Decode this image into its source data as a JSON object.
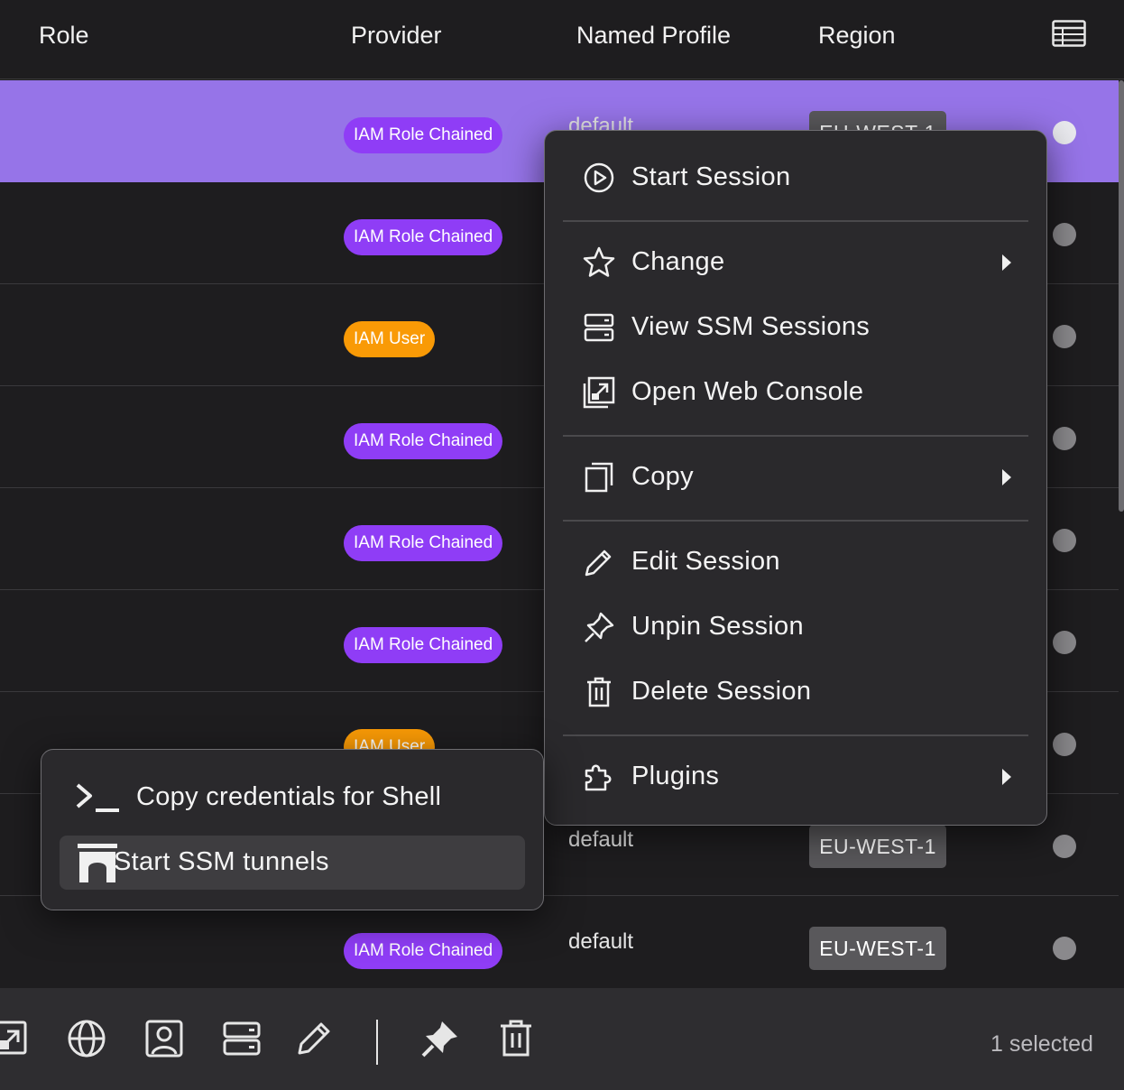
{
  "header": {
    "role": "Role",
    "provider": "Provider",
    "named_profile": "Named Profile",
    "region": "Region"
  },
  "rows": [
    {
      "provider": "IAM Role Chained",
      "provider_color": "purple",
      "profile": "default",
      "region": "EU-WEST-1",
      "selected": true
    },
    {
      "provider": "IAM Role Chained",
      "provider_color": "purple"
    },
    {
      "provider": "IAM User",
      "provider_color": "orange"
    },
    {
      "provider": "IAM Role Chained",
      "provider_color": "purple"
    },
    {
      "provider": "IAM Role Chained",
      "provider_color": "purple"
    },
    {
      "provider": "IAM Role Chained",
      "provider_color": "purple"
    },
    {
      "provider": "IAM User",
      "provider_color": "orange"
    },
    {
      "provider": "",
      "profile": "default",
      "region": "EU-WEST-1"
    },
    {
      "provider": "IAM Role Chained",
      "provider_color": "purple",
      "profile": "default",
      "region": "EU-WEST-1"
    }
  ],
  "context_menu": {
    "start_session": "Start Session",
    "change": "Change",
    "view_ssm": "View SSM Sessions",
    "open_console": "Open Web Console",
    "copy": "Copy",
    "edit": "Edit Session",
    "unpin": "Unpin Session",
    "delete": "Delete Session",
    "plugins": "Plugins"
  },
  "submenu": {
    "copy_shell": "Copy credentials for Shell",
    "ssm_tunnels": "Start SSM tunnels"
  },
  "toolbar": {
    "selected_count": "1 selected"
  },
  "colors": {
    "selected_row": "#9674e8",
    "badge_purple": "#8f3df6",
    "badge_orange": "#f99a06",
    "menu_bg": "#2a292c",
    "window_bg": "#1e1d1f"
  }
}
